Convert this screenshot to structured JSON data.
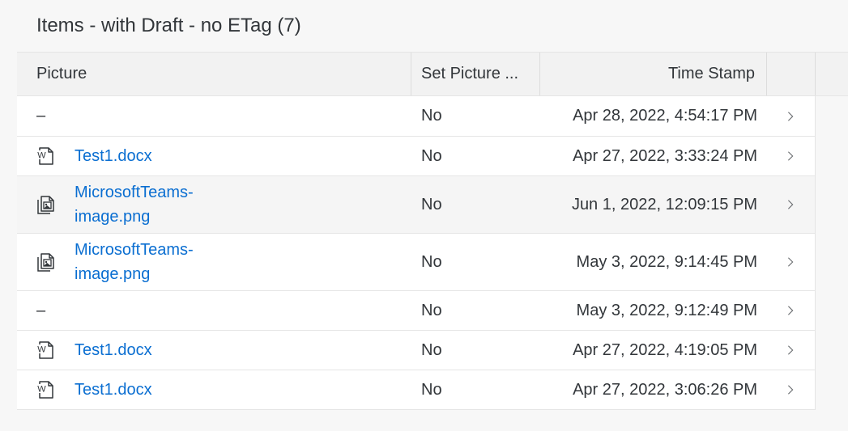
{
  "table": {
    "title": "Items - with Draft - no ETag (7)",
    "columns": {
      "picture": "Picture",
      "set_picture": "Set Picture ...",
      "time_stamp": "Time Stamp"
    },
    "rows": [
      {
        "file_name": "",
        "placeholder": "–",
        "file_type": "none",
        "set_picture": "No",
        "time_stamp": "Apr 28, 2022, 4:54:17 PM",
        "selected": false
      },
      {
        "file_name": "Test1.docx",
        "placeholder": "",
        "file_type": "word-document-icon",
        "set_picture": "No",
        "time_stamp": "Apr 27, 2022, 3:33:24 PM",
        "selected": false
      },
      {
        "file_name": "MicrosoftTeams-\nimage.png",
        "placeholder": "",
        "file_type": "image-file-icon",
        "set_picture": "No",
        "time_stamp": "Jun 1, 2022, 12:09:15 PM",
        "selected": true
      },
      {
        "file_name": "MicrosoftTeams-\nimage.png",
        "placeholder": "",
        "file_type": "image-file-icon",
        "set_picture": "No",
        "time_stamp": "May 3, 2022, 9:14:45 PM",
        "selected": false
      },
      {
        "file_name": "",
        "placeholder": "–",
        "file_type": "none",
        "set_picture": "No",
        "time_stamp": "May 3, 2022, 9:12:49 PM",
        "selected": false
      },
      {
        "file_name": "Test1.docx",
        "placeholder": "",
        "file_type": "word-document-icon",
        "set_picture": "No",
        "time_stamp": "Apr 27, 2022, 4:19:05 PM",
        "selected": false
      },
      {
        "file_name": "Test1.docx",
        "placeholder": "",
        "file_type": "word-document-icon",
        "set_picture": "No",
        "time_stamp": "Apr 27, 2022, 3:06:26 PM",
        "selected": false
      }
    ]
  },
  "colors": {
    "link": "#0a6ed1",
    "text": "#32363a",
    "header_bg": "#f2f2f2",
    "selected_row_bg": "#f5f5f5",
    "page_bg": "#f7f7f7"
  }
}
